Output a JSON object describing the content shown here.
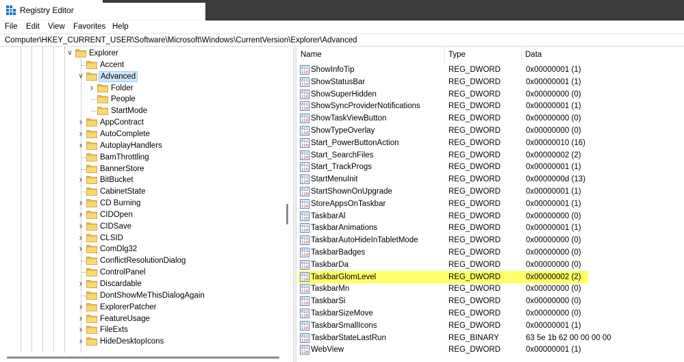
{
  "window": {
    "title": "Registry Editor"
  },
  "menu": [
    "File",
    "Edit",
    "View",
    "Favorites",
    "Help"
  ],
  "address": {
    "path": "Computer\\HKEY_CURRENT_USER\\Software\\Microsoft\\Windows\\CurrentVersion\\Explorer\\Advanced"
  },
  "tree": {
    "items": [
      {
        "label": "Explorer",
        "level": 0,
        "expander": "expanded"
      },
      {
        "label": "Accent",
        "level": 1,
        "expander": "none"
      },
      {
        "label": "Advanced",
        "level": 1,
        "expander": "expanded",
        "selected": true
      },
      {
        "label": "Folder",
        "level": 2,
        "expander": "collapsed"
      },
      {
        "label": "People",
        "level": 2,
        "expander": "none"
      },
      {
        "label": "StartMode",
        "level": 2,
        "expander": "none"
      },
      {
        "label": "AppContract",
        "level": 1,
        "expander": "collapsed"
      },
      {
        "label": "AutoComplete",
        "level": 1,
        "expander": "collapsed"
      },
      {
        "label": "AutoplayHandlers",
        "level": 1,
        "expander": "collapsed"
      },
      {
        "label": "BamThrottling",
        "level": 1,
        "expander": "none"
      },
      {
        "label": "BannerStore",
        "level": 1,
        "expander": "none"
      },
      {
        "label": "BitBucket",
        "level": 1,
        "expander": "collapsed"
      },
      {
        "label": "CabinetState",
        "level": 1,
        "expander": "none"
      },
      {
        "label": "CD Burning",
        "level": 1,
        "expander": "collapsed"
      },
      {
        "label": "CIDOpen",
        "level": 1,
        "expander": "collapsed"
      },
      {
        "label": "CIDSave",
        "level": 1,
        "expander": "collapsed"
      },
      {
        "label": "CLSID",
        "level": 1,
        "expander": "collapsed"
      },
      {
        "label": "ComDlg32",
        "level": 1,
        "expander": "collapsed"
      },
      {
        "label": "ConflictResolutionDialog",
        "level": 1,
        "expander": "none"
      },
      {
        "label": "ControlPanel",
        "level": 1,
        "expander": "none"
      },
      {
        "label": "Discardable",
        "level": 1,
        "expander": "collapsed"
      },
      {
        "label": "DontShowMeThisDialogAgain",
        "level": 1,
        "expander": "none"
      },
      {
        "label": "ExplorerPatcher",
        "level": 1,
        "expander": "collapsed"
      },
      {
        "label": "FeatureUsage",
        "level": 1,
        "expander": "collapsed"
      },
      {
        "label": "FileExts",
        "level": 1,
        "expander": "collapsed"
      },
      {
        "label": "HideDesktopIcons",
        "level": 1,
        "expander": "collapsed"
      }
    ]
  },
  "list": {
    "columns": {
      "name": "Name",
      "type": "Type",
      "data": "Data"
    },
    "rows": [
      {
        "name": "ShowInfoTip",
        "type": "REG_DWORD",
        "data": "0x00000001 (1)"
      },
      {
        "name": "ShowStatusBar",
        "type": "REG_DWORD",
        "data": "0x00000001 (1)"
      },
      {
        "name": "ShowSuperHidden",
        "type": "REG_DWORD",
        "data": "0x00000000 (0)"
      },
      {
        "name": "ShowSyncProviderNotifications",
        "type": "REG_DWORD",
        "data": "0x00000001 (1)"
      },
      {
        "name": "ShowTaskViewButton",
        "type": "REG_DWORD",
        "data": "0x00000000 (0)"
      },
      {
        "name": "ShowTypeOverlay",
        "type": "REG_DWORD",
        "data": "0x00000000 (0)"
      },
      {
        "name": "Start_PowerButtonAction",
        "type": "REG_DWORD",
        "data": "0x00000010 (16)"
      },
      {
        "name": "Start_SearchFiles",
        "type": "REG_DWORD",
        "data": "0x00000002 (2)"
      },
      {
        "name": "Start_TrackProgs",
        "type": "REG_DWORD",
        "data": "0x00000001 (1)"
      },
      {
        "name": "StartMenuInit",
        "type": "REG_DWORD",
        "data": "0x0000000d (13)"
      },
      {
        "name": "StartShownOnUpgrade",
        "type": "REG_DWORD",
        "data": "0x00000001 (1)"
      },
      {
        "name": "StoreAppsOnTaskbar",
        "type": "REG_DWORD",
        "data": "0x00000001 (1)"
      },
      {
        "name": "TaskbarAl",
        "type": "REG_DWORD",
        "data": "0x00000000 (0)"
      },
      {
        "name": "TaskbarAnimations",
        "type": "REG_DWORD",
        "data": "0x00000001 (1)"
      },
      {
        "name": "TaskbarAutoHideInTabletMode",
        "type": "REG_DWORD",
        "data": "0x00000000 (0)"
      },
      {
        "name": "TaskbarBadges",
        "type": "REG_DWORD",
        "data": "0x00000000 (0)"
      },
      {
        "name": "TaskbarDa",
        "type": "REG_DWORD",
        "data": "0x00000000 (0)"
      },
      {
        "name": "TaskbarGlomLevel",
        "type": "REG_DWORD",
        "data": "0x00000002 (2)",
        "highlighted": true
      },
      {
        "name": "TaskbarMn",
        "type": "REG_DWORD",
        "data": "0x00000000 (0)"
      },
      {
        "name": "TaskbarSi",
        "type": "REG_DWORD",
        "data": "0x00000000 (0)"
      },
      {
        "name": "TaskbarSizeMove",
        "type": "REG_DWORD",
        "data": "0x00000000 (0)"
      },
      {
        "name": "TaskbarSmallIcons",
        "type": "REG_DWORD",
        "data": "0x00000001 (1)"
      },
      {
        "name": "TaskbarStateLastRun",
        "type": "REG_BINARY",
        "data": "63 5e 1b 62 00 00 00 00"
      },
      {
        "name": "WebView",
        "type": "REG_DWORD",
        "data": "0x00000001 (1)"
      }
    ]
  },
  "colors": {
    "highlight": "#ffff66",
    "selection": "#cce8ff",
    "folder": "#f8d775"
  }
}
